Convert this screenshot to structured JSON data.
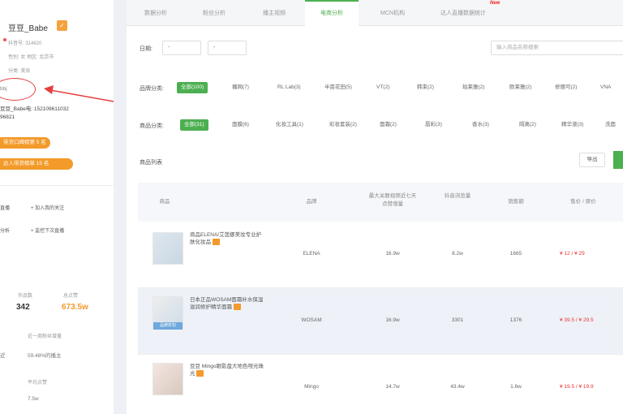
{
  "profile": {
    "name": "豆豆_Babe",
    "meta": [
      "抖音号: 314620",
      "性别: 女  地区: 北京市",
      "分类: 美妆"
    ],
    "link": "bbj",
    "contact": [
      "豆豆_Babe电: 152109611032",
      "96821"
    ],
    "pill1": "带货口碑榜第 5 名",
    "pill2": "达人带货榜单 15 名",
    "actions": [
      "直播",
      "加入我的关注",
      "分析",
      "监控下次直播"
    ],
    "stats": {
      "label1": "作品数",
      "val1": "342",
      "label2": "总点赞",
      "val2": "673.5w",
      "label3": "近一周粉丝增量",
      "val3": "59.48%的播主",
      "label4": "平均点赞",
      "val4": "7.5w"
    }
  },
  "tabs": [
    "数据分析",
    "粉丝分析",
    "播主视频",
    "电商分析",
    "MCN机构",
    "达人直播数据统计"
  ],
  "new_badge": "New",
  "date_filter": {
    "label": "日期:",
    "start": "-",
    "end": "-"
  },
  "search_placeholder": "输入商品名称搜索",
  "brand_filter": {
    "label": "品牌分类:",
    "items": [
      "全部(100)",
      "播网(7)",
      "RL Lab(3)",
      "半亩花田(5)",
      "VT(2)",
      "韩束(2)",
      "珀莱雅(2)",
      "欧莱雅(2)",
      "修丽可(2)",
      "VNA"
    ]
  },
  "category_filter": {
    "label": "商品分类:",
    "items": [
      "全部(31)",
      "面膜(6)",
      "化妆工具(1)",
      "彩妆套装(2)",
      "面霜(2)",
      "唇彩(3)",
      "香水(3)",
      "隔离(2)",
      "精华液(3)",
      "洗面"
    ]
  },
  "list": {
    "title": "商品列表",
    "export_label": "导出",
    "columns": [
      "商品",
      "品牌",
      "最大关联视频近七天点赞增量",
      "抖音浏览量",
      "销售额",
      "售价 / 原价"
    ],
    "rows": [
      {
        "name": "商品ELENA/艾莲娜美妆专业护肤化妆品",
        "brand": "ELENA",
        "likes": "16.9w",
        "views": "8.2w",
        "sales": "1665",
        "price": "¥ 12 / ¥ 29",
        "tag": ""
      },
      {
        "name": "日本正品WOSAM面霜补水保湿滋润修护精华面霜",
        "brand": "WOSAM",
        "likes": "16.9w",
        "views": "3301",
        "sales": "1376",
        "price": "¥ 39.5 / ¥ 29.5",
        "tag": "品牌折扣"
      },
      {
        "name": "豆豆 Mingo眼影盘大地色哑光珠光",
        "brand": "Mingo",
        "likes": "14.7w",
        "views": "43.4w",
        "sales": "1.6w",
        "price": "¥ 19.5 / ¥ 19.9",
        "tag": ""
      }
    ]
  }
}
